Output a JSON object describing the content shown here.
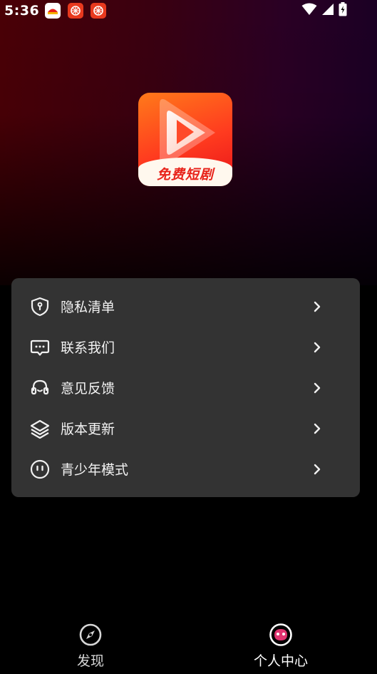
{
  "status_bar": {
    "time": "5:36",
    "icons": [
      "notification-app-icon",
      "notification-app-icon",
      "notification-app-icon",
      "wifi-icon",
      "signal-icon",
      "battery-charging-icon"
    ]
  },
  "app": {
    "logo_text": "免费短剧",
    "logo_colors": {
      "top": "#ff7a1a",
      "bottom": "#e8141a",
      "banner": "#fff8ee"
    }
  },
  "menu": {
    "items": [
      {
        "label": "隐私清单",
        "icon": "shield-lock-icon"
      },
      {
        "label": "联系我们",
        "icon": "chat-icon"
      },
      {
        "label": "意见反馈",
        "icon": "headset-icon"
      },
      {
        "label": "版本更新",
        "icon": "layers-icon"
      },
      {
        "label": "青少年模式",
        "icon": "smiley-icon"
      }
    ]
  },
  "bottom_nav": {
    "items": [
      {
        "label": "发现",
        "icon": "compass-icon",
        "active": false
      },
      {
        "label": "个人中心",
        "icon": "profile-face-icon",
        "active": true
      }
    ]
  },
  "colors": {
    "background": "#000000",
    "card": "#333333",
    "hero_left": "#4a0006",
    "hero_right": "#1b0024",
    "accent": "#e0336f"
  }
}
